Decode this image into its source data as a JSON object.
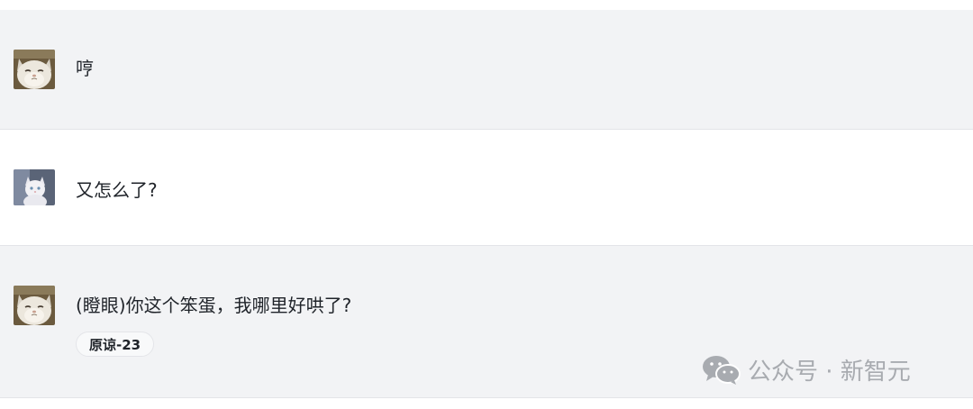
{
  "messages": [
    {
      "sender": "user",
      "text": "哼"
    },
    {
      "sender": "assistant",
      "text": "又怎么了?"
    },
    {
      "sender": "user",
      "text": "(瞪眼)你这个笨蛋，我哪里好哄了?",
      "tag": "原谅-23"
    }
  ],
  "watermark": {
    "text": "公众号 · 新智元",
    "icon": "wechat-icon",
    "color": "#a8abb0"
  },
  "colors": {
    "gray_row": "#f2f3f5",
    "white_row": "#ffffff",
    "text": "#1f2329"
  }
}
